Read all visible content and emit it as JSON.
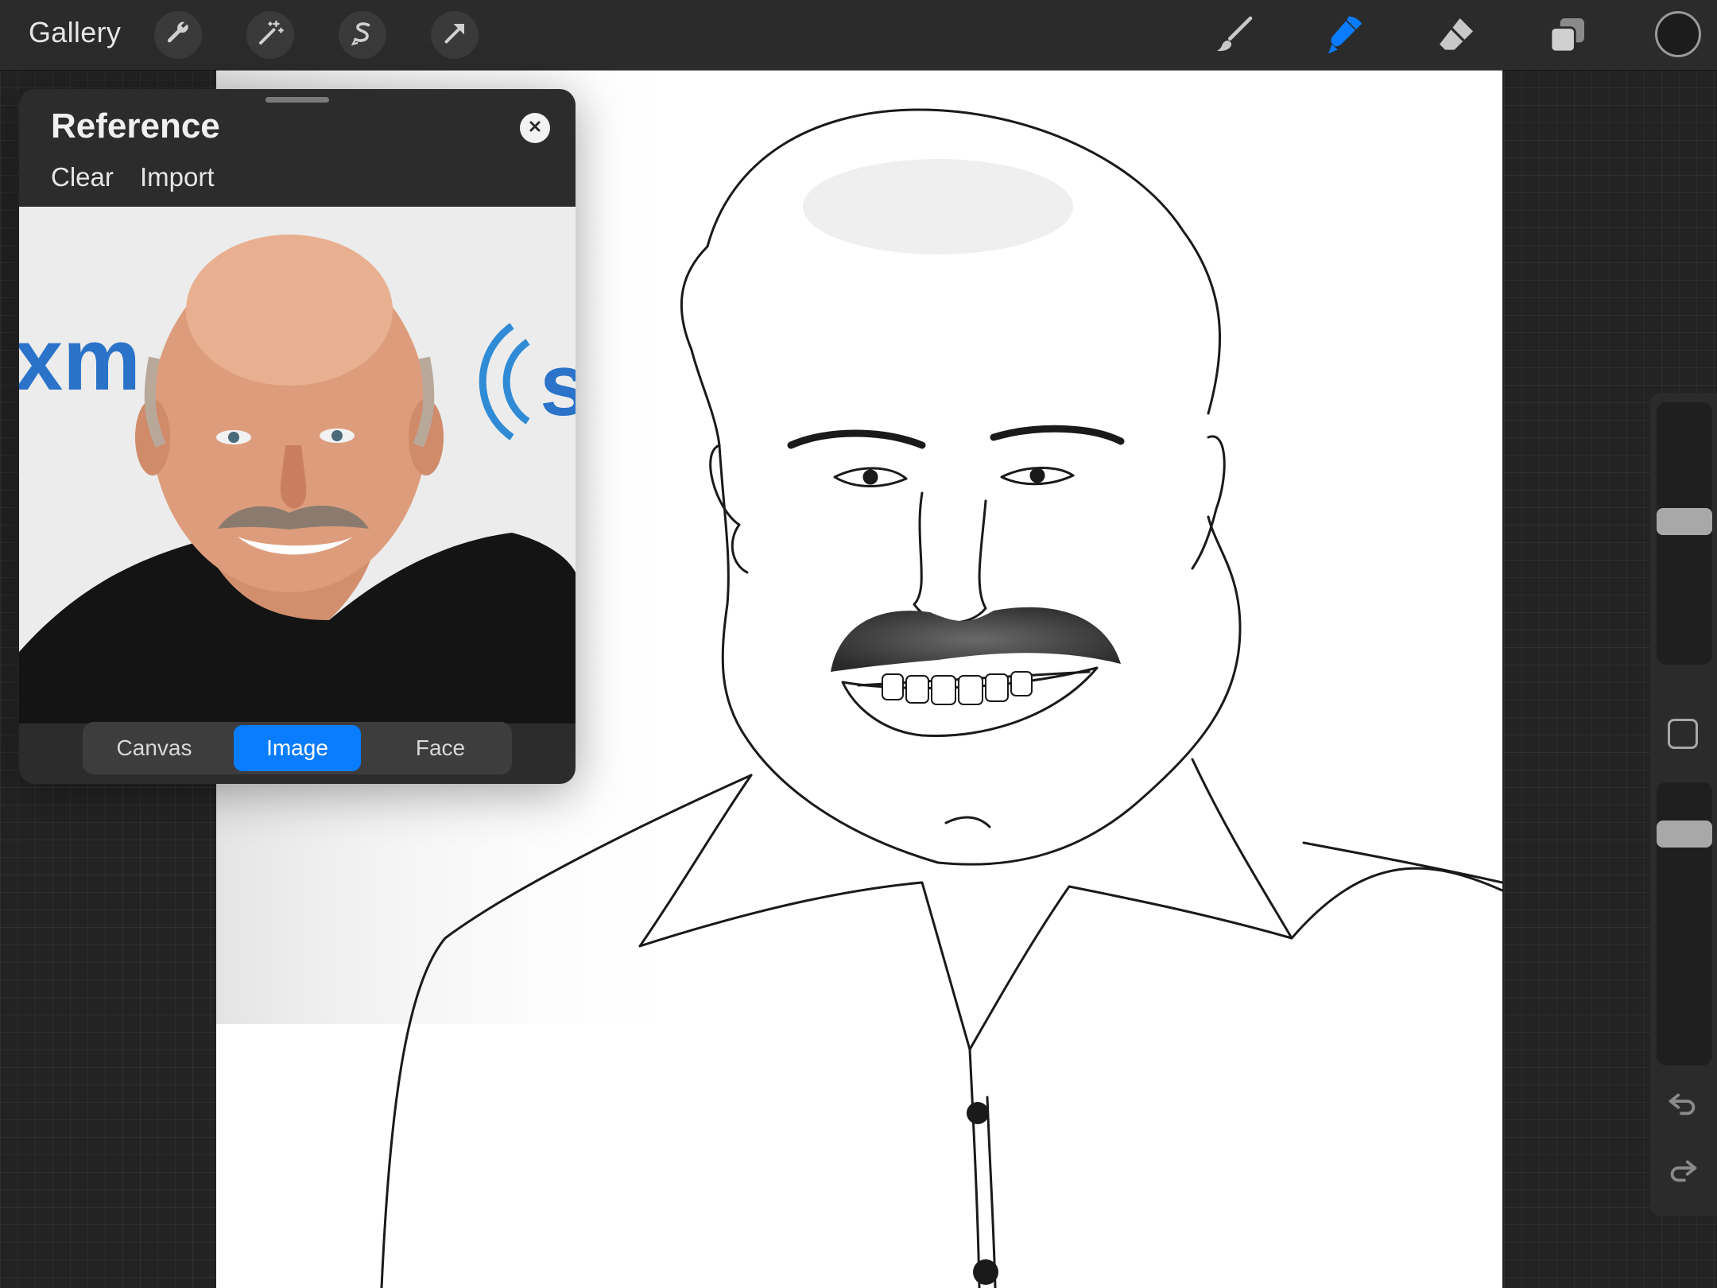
{
  "toolbar": {
    "gallery_label": "Gallery",
    "left_tools": [
      "wrench-icon",
      "magic-wand-icon",
      "selection-icon",
      "transform-arrow-icon"
    ],
    "right_tools": [
      "brush-icon",
      "smudge-icon",
      "eraser-icon",
      "layers-icon"
    ],
    "active_tool": "smudge-icon",
    "accent_color": "#0a7cff",
    "current_color": "#1c1c1c"
  },
  "reference_panel": {
    "title": "Reference",
    "actions": {
      "clear": "Clear",
      "import": "Import"
    },
    "image_text": {
      "left_logo": "xm",
      "right_logo": "s"
    },
    "modes": [
      {
        "label": "Canvas",
        "active": false
      },
      {
        "label": "Image",
        "active": true
      },
      {
        "label": "Face",
        "active": false
      }
    ]
  },
  "sidebar": {
    "brush_size_level": 0.55,
    "opacity_level": 0.85,
    "icons": [
      "modifier-square-icon",
      "undo-icon",
      "redo-icon"
    ]
  }
}
